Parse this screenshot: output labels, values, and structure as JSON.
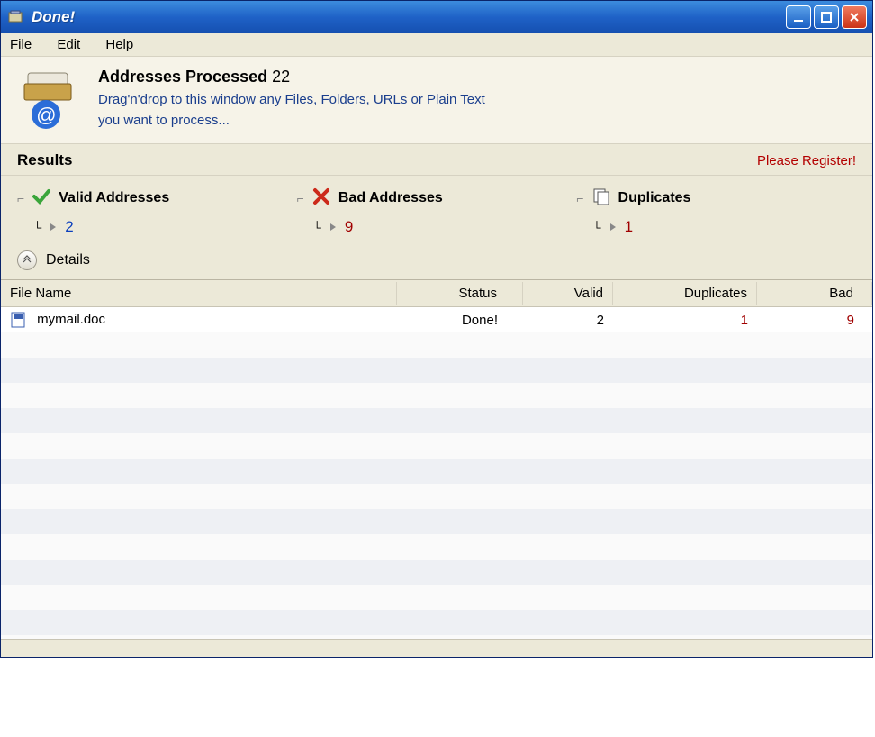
{
  "window": {
    "title": "Done!"
  },
  "menubar": {
    "file": "File",
    "edit": "Edit",
    "help": "Help"
  },
  "header": {
    "title_bold": "Addresses Processed",
    "title_count": "22",
    "sub_line1": "Drag'n'drop to this window any Files, Folders, URLs or Plain Text",
    "sub_line2": "you want to process..."
  },
  "results": {
    "label": "Results",
    "register": "Please Register!"
  },
  "summary": {
    "valid_label": "Valid Addresses",
    "valid_count": "2",
    "bad_label": "Bad Addresses",
    "bad_count": "9",
    "dup_label": "Duplicates",
    "dup_count": "1"
  },
  "details": {
    "label": "Details"
  },
  "table": {
    "columns": {
      "name": "File Name",
      "status": "Status",
      "valid": "Valid",
      "duplicates": "Duplicates",
      "bad": "Bad"
    },
    "row": {
      "name": "mymail.doc",
      "status": "Done!",
      "valid": "2",
      "duplicates": "1",
      "bad": "9"
    }
  }
}
